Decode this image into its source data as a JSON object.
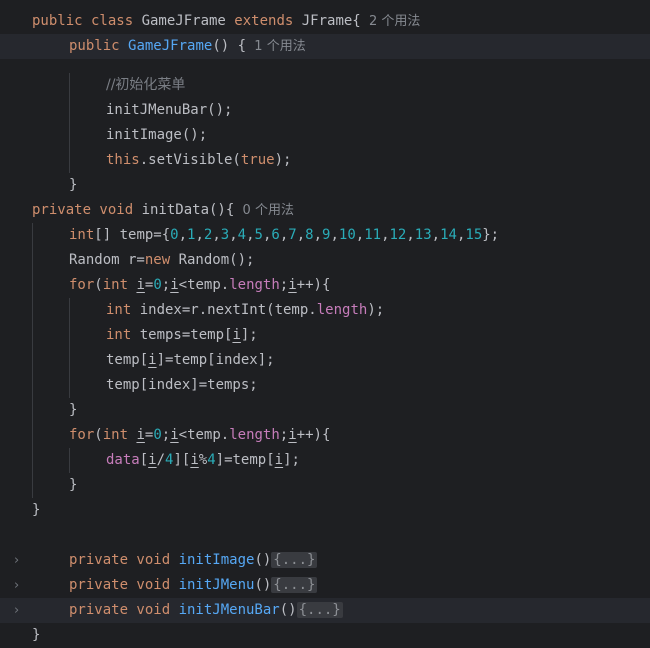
{
  "editor": {
    "lines": [
      {
        "tokens": [
          [
            "kw",
            "public class "
          ],
          [
            "plain",
            "GameJFrame "
          ],
          [
            "kw",
            "extends "
          ],
          [
            "plain",
            "JFrame{"
          ],
          [
            "hint",
            "  2 个用法"
          ]
        ]
      },
      {
        "indent": 1,
        "tokens": [
          [
            "kw",
            "public "
          ],
          [
            "fn",
            "GameJFrame"
          ],
          [
            "plain",
            "() {"
          ],
          [
            "hint",
            "  1 个用法"
          ]
        ]
      },
      {
        "indent": 2,
        "tokens": [
          [
            "cm",
            "//初始化菜单"
          ]
        ]
      },
      {
        "indent": 2,
        "tokens": [
          [
            "plain",
            "initJMenuBar();"
          ]
        ]
      },
      {
        "indent": 2,
        "tokens": [
          [
            "plain",
            "initImage();"
          ]
        ]
      },
      {
        "indent": 2,
        "tokens": [
          [
            "kw",
            "this"
          ],
          [
            "plain",
            ".setVisible("
          ],
          [
            "kw",
            "true"
          ],
          [
            "plain",
            ");"
          ]
        ]
      },
      {
        "indent": 1,
        "tokens": [
          [
            "plain",
            "}"
          ]
        ]
      },
      {
        "indent": 0,
        "tokens": [
          [
            "kw",
            "private void "
          ],
          [
            "plain",
            "initData(){"
          ],
          [
            "hint",
            "  0 个用法"
          ]
        ]
      },
      {
        "indent": 1,
        "tokens": [
          [
            "kw",
            "int"
          ],
          [
            "plain",
            "[] temp={"
          ],
          [
            "num",
            "0"
          ],
          [
            "plain",
            ","
          ],
          [
            "num",
            "1"
          ],
          [
            "plain",
            ","
          ],
          [
            "num",
            "2"
          ],
          [
            "plain",
            ","
          ],
          [
            "num",
            "3"
          ],
          [
            "plain",
            ","
          ],
          [
            "num",
            "4"
          ],
          [
            "plain",
            ","
          ],
          [
            "num",
            "5"
          ],
          [
            "plain",
            ","
          ],
          [
            "num",
            "6"
          ],
          [
            "plain",
            ","
          ],
          [
            "num",
            "7"
          ],
          [
            "plain",
            ","
          ],
          [
            "num",
            "8"
          ],
          [
            "plain",
            ","
          ],
          [
            "num",
            "9"
          ],
          [
            "plain",
            ","
          ],
          [
            "num",
            "10"
          ],
          [
            "plain",
            ","
          ],
          [
            "num",
            "11"
          ],
          [
            "plain",
            ","
          ],
          [
            "num",
            "12"
          ],
          [
            "plain",
            ","
          ],
          [
            "num",
            "13"
          ],
          [
            "plain",
            ","
          ],
          [
            "num",
            "14"
          ],
          [
            "plain",
            ","
          ],
          [
            "num",
            "15"
          ],
          [
            "plain",
            "};"
          ]
        ]
      },
      {
        "indent": 1,
        "tokens": [
          [
            "plain",
            "Random r="
          ],
          [
            "kw",
            "new "
          ],
          [
            "plain",
            "Random();"
          ]
        ]
      },
      {
        "indent": 1,
        "tokens": [
          [
            "kw",
            "for"
          ],
          [
            "plain",
            "("
          ],
          [
            "kw",
            "int "
          ],
          [
            "ul",
            "i"
          ],
          [
            "plain",
            "="
          ],
          [
            "num",
            "0"
          ],
          [
            "plain",
            ";"
          ],
          [
            "ul",
            "i"
          ],
          [
            "plain",
            "<temp."
          ],
          [
            "field",
            "length"
          ],
          [
            "plain",
            ";"
          ],
          [
            "ul",
            "i"
          ],
          [
            "plain",
            "++){"
          ]
        ]
      },
      {
        "indent": 2,
        "tokens": [
          [
            "kw",
            "int "
          ],
          [
            "plain",
            "index=r.nextInt(temp."
          ],
          [
            "field",
            "length"
          ],
          [
            "plain",
            ");"
          ]
        ]
      },
      {
        "indent": 2,
        "tokens": [
          [
            "kw",
            "int "
          ],
          [
            "plain",
            "temps=temp["
          ],
          [
            "ul",
            "i"
          ],
          [
            "plain",
            "];"
          ]
        ]
      },
      {
        "indent": 2,
        "tokens": [
          [
            "plain",
            "temp["
          ],
          [
            "ul",
            "i"
          ],
          [
            "plain",
            "]=temp[index];"
          ]
        ]
      },
      {
        "indent": 2,
        "tokens": [
          [
            "plain",
            "temp[index]=temps;"
          ]
        ]
      },
      {
        "indent": 1,
        "tokens": [
          [
            "plain",
            "}"
          ]
        ]
      },
      {
        "indent": 1,
        "tokens": [
          [
            "kw",
            "for"
          ],
          [
            "plain",
            "("
          ],
          [
            "kw",
            "int "
          ],
          [
            "ul",
            "i"
          ],
          [
            "plain",
            "="
          ],
          [
            "num",
            "0"
          ],
          [
            "plain",
            ";"
          ],
          [
            "ul",
            "i"
          ],
          [
            "plain",
            "<temp."
          ],
          [
            "field",
            "length"
          ],
          [
            "plain",
            ";"
          ],
          [
            "ul",
            "i"
          ],
          [
            "plain",
            "++){"
          ]
        ]
      },
      {
        "indent": 2,
        "tokens": [
          [
            "field",
            "data"
          ],
          [
            "plain",
            "["
          ],
          [
            "ul",
            "i"
          ],
          [
            "plain",
            "/"
          ],
          [
            "num",
            "4"
          ],
          [
            "plain",
            "]["
          ],
          [
            "ul",
            "i"
          ],
          [
            "plain",
            "%"
          ],
          [
            "num",
            "4"
          ],
          [
            "plain",
            "]=temp["
          ],
          [
            "ul",
            "i"
          ],
          [
            "plain",
            "];"
          ]
        ]
      },
      {
        "indent": 1,
        "tokens": [
          [
            "plain",
            "}"
          ]
        ]
      },
      {
        "indent": 0,
        "tokens": [
          [
            "plain",
            "}"
          ]
        ]
      },
      {
        "indent": 0,
        "tokens": []
      },
      {
        "indent": 1,
        "fold": true,
        "tokens": [
          [
            "kw",
            "private void "
          ],
          [
            "fn",
            "initImage"
          ],
          [
            "plain",
            "()"
          ],
          [
            "collapsed",
            "{...}"
          ]
        ]
      },
      {
        "indent": 1,
        "fold": true,
        "tokens": [
          [
            "kw",
            "private void "
          ],
          [
            "fn",
            "initJMenu"
          ],
          [
            "plain",
            "()"
          ],
          [
            "collapsed",
            "{...}"
          ]
        ]
      },
      {
        "indent": 1,
        "fold": true,
        "highlight": true,
        "tokens": [
          [
            "kw",
            "private void "
          ],
          [
            "fn",
            "initJMenuBar"
          ],
          [
            "plain",
            "()"
          ],
          [
            "collapsed",
            "{...}"
          ]
        ]
      },
      {
        "indent": 0,
        "tokens": [
          [
            "plain",
            "}"
          ]
        ]
      }
    ]
  },
  "colors": {
    "background": "#1e1f22",
    "keyword": "#cf8e6d",
    "method": "#56a8f5",
    "number": "#2aacb8",
    "field": "#c77dbb",
    "comment": "#7a7e85",
    "text": "#bcbec4"
  },
  "icons": {
    "fold": "chevron-right-icon"
  }
}
